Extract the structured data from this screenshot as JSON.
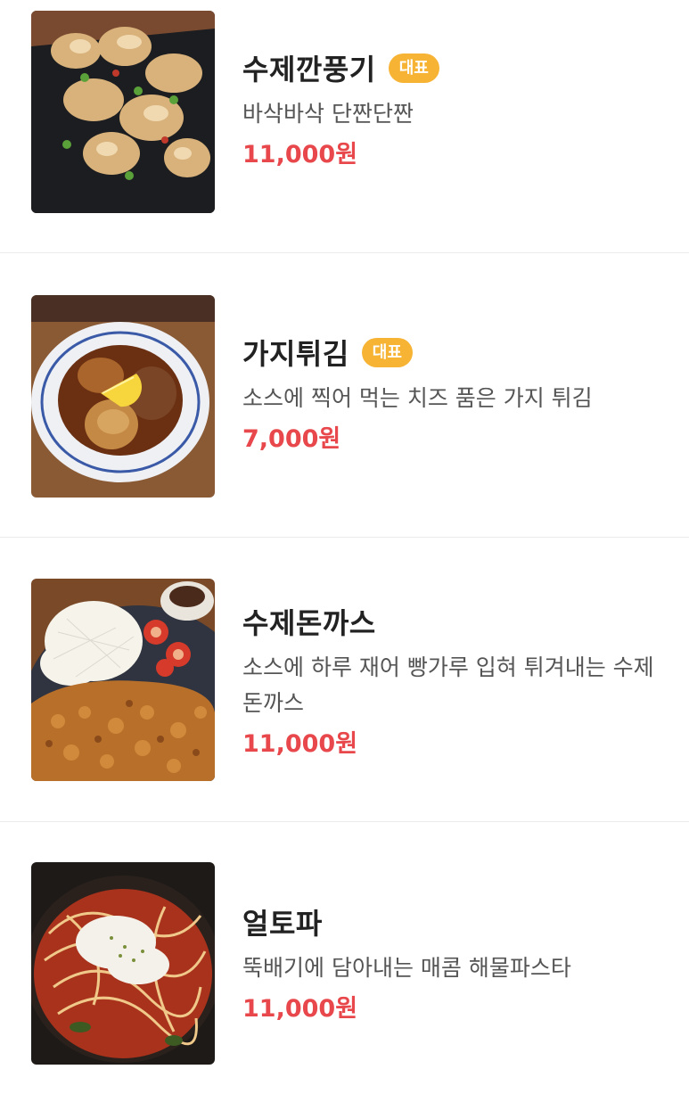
{
  "menu": {
    "items": [
      {
        "name": "수제깐풍기",
        "badge": "대표",
        "description": "바삭바삭 단짠단짠",
        "price": "11,000원",
        "image": "fried-chicken-photo"
      },
      {
        "name": "가지튀김",
        "badge": "대표",
        "description": "소스에 찍어 먹는 치즈 품은 가지 튀김",
        "price": "7,000원",
        "image": "fried-eggplant-photo"
      },
      {
        "name": "수제돈까스",
        "description": "소스에 하루 재어 빵가루 입혀 튀겨내는 수제돈까스",
        "price": "11,000원",
        "image": "pork-cutlet-photo"
      },
      {
        "name": "얼토파",
        "description": "뚝배기에 담아내는 매콤 해물파스타",
        "price": "11,000원",
        "image": "spicy-seafood-pasta-photo"
      }
    ]
  },
  "colors": {
    "badge": "#f6b334",
    "price": "#e8474b",
    "divider": "#ebebeb"
  }
}
